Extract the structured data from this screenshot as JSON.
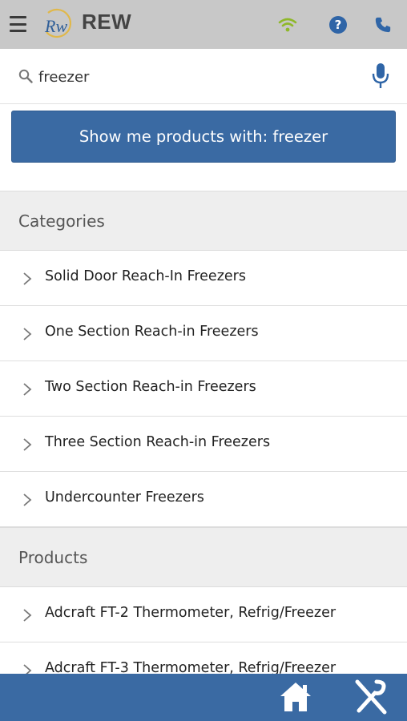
{
  "header": {
    "brand": "REW",
    "logo_text": "Rw",
    "icons": [
      "menu-icon",
      "wifi-icon",
      "help-icon",
      "phone-icon"
    ],
    "colors": {
      "bar": "#c8c8c8",
      "wifi": "#8fb82a",
      "accent": "#2f65a7"
    }
  },
  "search": {
    "value": "freezer",
    "placeholder": ""
  },
  "show_button": {
    "label": "Show me products with: freezer"
  },
  "categories": {
    "title": "Categories",
    "items": [
      {
        "label": "Solid Door Reach-In Freezers"
      },
      {
        "label": "One Section Reach-in Freezers"
      },
      {
        "label": "Two Section Reach-in Freezers"
      },
      {
        "label": "Three Section Reach-in Freezers"
      },
      {
        "label": "Undercounter Freezers"
      }
    ]
  },
  "products": {
    "title": "Products",
    "items": [
      {
        "label": "Adcraft FT-2 Thermometer, Refrig/Freezer"
      },
      {
        "label": "Adcraft FT-3 Thermometer, Refrig/Freezer"
      }
    ]
  },
  "footer": {
    "icons": [
      "home-icon",
      "utensils-icon"
    ],
    "color": "#3a6aa3"
  }
}
